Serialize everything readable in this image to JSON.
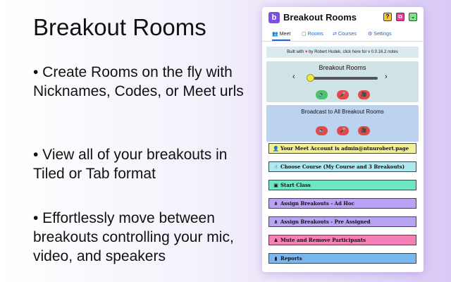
{
  "promo": {
    "heading": "Breakout Rooms",
    "bullets": [
      "• Create Rooms on the fly with Nicknames, Codes, or Meet urls",
      "• View all of your breakouts in Tiled or Tab format",
      "• Effortlessly move between breakouts controlling your mic, video, and speakers"
    ]
  },
  "app": {
    "logo_letter": "b",
    "title": "Breakout Rooms",
    "header_buttons": [
      "?",
      "⧉",
      "⌄"
    ],
    "tabs": [
      {
        "icon": "👥",
        "label": "Meet"
      },
      {
        "icon": "▢",
        "label": "Rooms"
      },
      {
        "icon": "⇄",
        "label": "Courses"
      },
      {
        "icon": "⚙",
        "label": "Settings"
      }
    ],
    "notice": {
      "before": "Built with ",
      "heart": "♥",
      "after": " by Robert Hudek, click here for v 0.0.16.2 notes"
    },
    "room_control": {
      "title": "Breakout Rooms",
      "prev": "‹",
      "next": "›",
      "slider_value": 0
    },
    "broadcast": {
      "title": "Broadcast to All Breakout Rooms"
    },
    "control_icons": [
      "🔈",
      "🎤",
      "🎥"
    ],
    "actions": [
      {
        "icon": "👤",
        "label": "Your Meet Account is admin@ntnurobert.page"
      },
      {
        "icon": "☝",
        "label": "Choose Course (My Course and 3 Breakouts)"
      },
      {
        "icon": "▣",
        "label": "Start Class"
      },
      {
        "icon": "⋔",
        "label": "Assign Breakouts - Ad Hoc"
      },
      {
        "icon": "⋔",
        "label": "Assign Breakouts - Pre Assigned"
      },
      {
        "icon": "♟",
        "label": "Mute and Remove Participants"
      },
      {
        "icon": "▮",
        "label": "Reports"
      }
    ]
  },
  "colors": {
    "accent": "#7b4fe0",
    "link": "#2166c8",
    "green": "#48c46a",
    "red": "#e34b4b"
  }
}
